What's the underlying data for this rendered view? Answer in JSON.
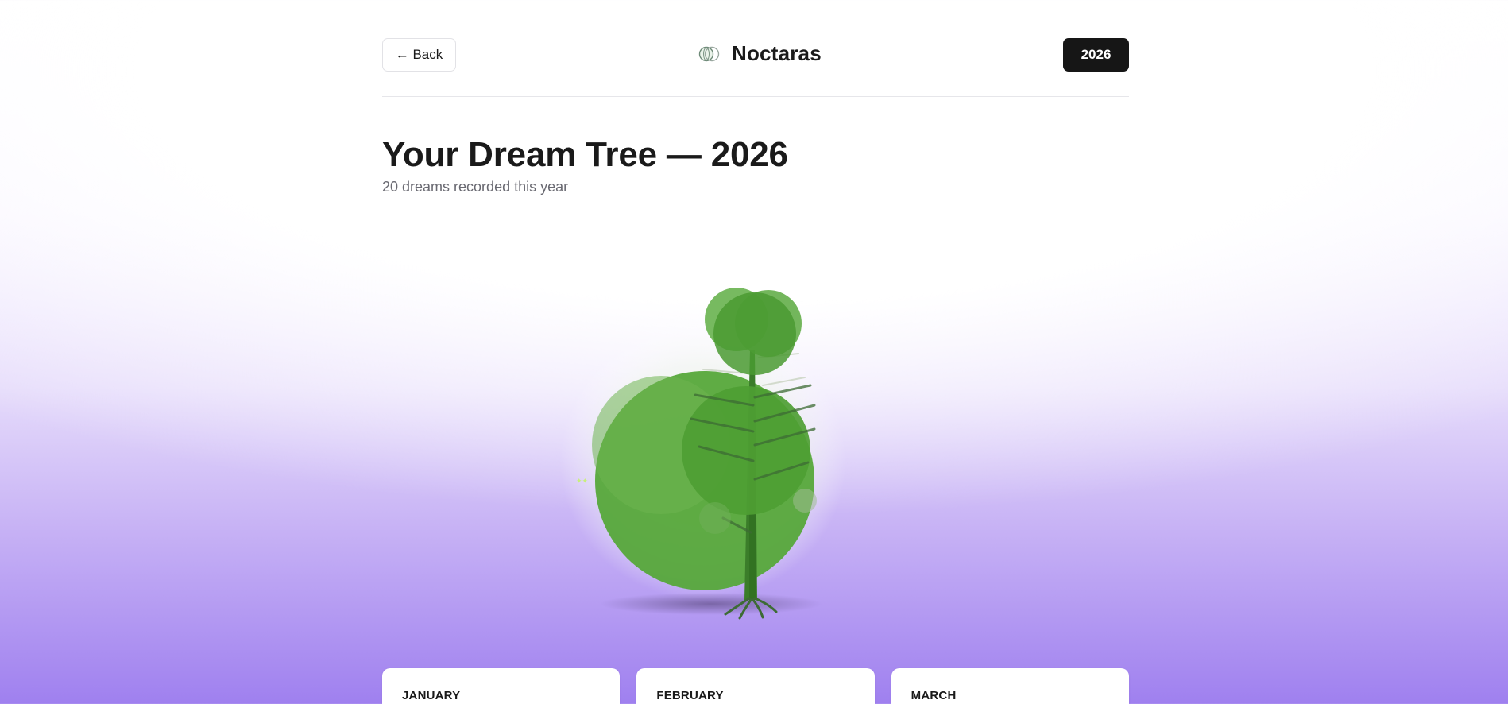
{
  "header": {
    "back_label": "← Back",
    "brand_name": "Noctaras",
    "year_label": "2026"
  },
  "main": {
    "title": "Your Dream Tree — 2026",
    "subtitle": "20 dreams recorded this year"
  },
  "tree": {
    "foliage_color": "#56a83a",
    "trunk_color": "#3b7d2a",
    "accent_color": "#a56bf0"
  },
  "months": [
    {
      "name": "JANUARY"
    },
    {
      "name": "FEBRUARY"
    },
    {
      "name": "MARCH"
    }
  ]
}
